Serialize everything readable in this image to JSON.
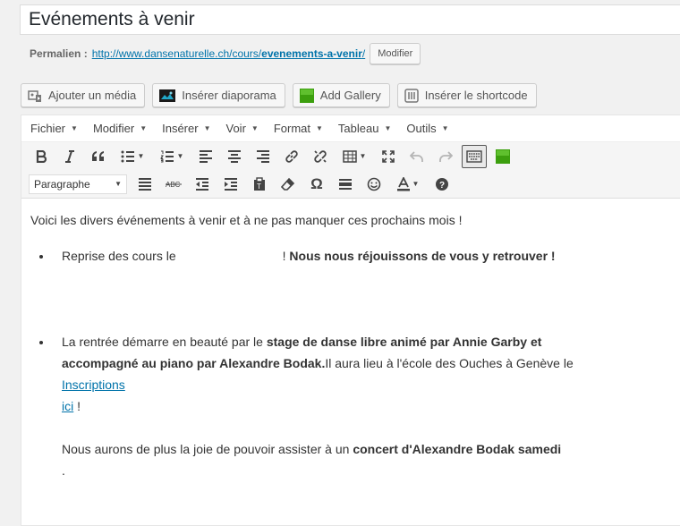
{
  "post": {
    "title": "Evénements à venir"
  },
  "permalink": {
    "label": "Permalien :",
    "url_base": "http://www.dansenaturelle.ch/cours/",
    "slug": "evenements-a-venir",
    "trailing": "/",
    "edit_button": "Modifier"
  },
  "media_buttons": [
    {
      "label": "Ajouter un média",
      "icon": "media-icon"
    },
    {
      "label": "Insérer diaporama",
      "icon": "slideshow-icon"
    },
    {
      "label": "Add Gallery",
      "icon": "gallery-green-square-icon"
    },
    {
      "label": "Insérer le shortcode",
      "icon": "shortcode-icon"
    }
  ],
  "menubar": [
    "Fichier",
    "Modifier",
    "Insérer",
    "Voir",
    "Format",
    "Tableau",
    "Outils"
  ],
  "toolbar2": {
    "format_select": "Paragraphe"
  },
  "content": {
    "intro": "Voici les divers événements à venir et à ne pas manquer ces prochains mois !",
    "item1_text": "Reprise des cours le",
    "item1_bang": "!",
    "item1_bold": "Nous nous réjouissons de vous y retrouver !",
    "item2_text1": "La rentrée démarre en beauté par le",
    "item2_bold": "stage de danse libre animé par Annie Garby et accompagné au piano par Alexandre Bodak.",
    "item2_text2": "Il aura lieu à l'école des Ouches à Genève le",
    "item2_link1": "Inscriptions",
    "item2_link2": "ici",
    "item2_text3": " !",
    "item2_text4": "Nous aurons de plus la joie de pouvoir assister à un",
    "item2_bold2": "concert d'Alexandre Bodak samedi",
    "item2_text5": "."
  },
  "colors": {
    "link": "#0073aa",
    "gallery_green": "#3c9f0e",
    "background": "#f1f1f1"
  }
}
